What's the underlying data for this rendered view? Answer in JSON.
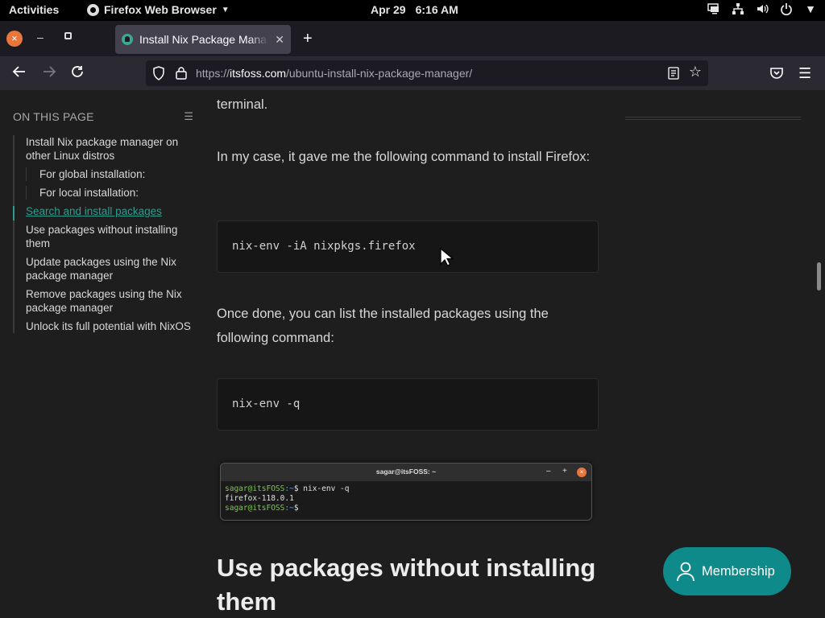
{
  "topbar": {
    "activities": "Activities",
    "app_name": "Firefox Web Browser",
    "date": "Apr 29",
    "time": "6:16 AM"
  },
  "tabs": [
    {
      "title": "Install Nix Package Manager",
      "favicon": "itsfoss-favicon"
    }
  ],
  "urlbar": {
    "scheme": "https://",
    "host": "itsfoss.com",
    "path": "/ubuntu-install-nix-package-manager/"
  },
  "toc": {
    "heading": "ON THIS PAGE",
    "items": [
      {
        "label": "Install Nix package manager on other Linux distros",
        "level": 1,
        "active": false
      },
      {
        "label": "For global installation:",
        "level": 2,
        "active": false
      },
      {
        "label": "For local installation:",
        "level": 2,
        "active": false
      },
      {
        "label": "Search and install packages",
        "level": 1,
        "active": true
      },
      {
        "label": "Use packages without installing them",
        "level": 1,
        "active": false
      },
      {
        "label": "Update packages using the Nix package manager",
        "level": 1,
        "active": false
      },
      {
        "label": "Remove packages using the Nix package manager",
        "level": 1,
        "active": false
      },
      {
        "label": "Unlock its full potential with NixOS",
        "level": 1,
        "active": false
      }
    ]
  },
  "article": {
    "p0": "terminal.",
    "p1": "In my case, it gave me the following command to install Firefox:",
    "code1": "nix-env -iA nixpkgs.firefox",
    "p2": "Once done, you can list the installed packages using the following command:",
    "code2": "nix-env -q",
    "terminal": {
      "title": "sagar@itsFOSS: ~",
      "min": "–",
      "max": "+",
      "close": "×",
      "line1_user": "sagar@itsFOSS",
      "line1_path": ":~",
      "line1_cmd": "$ nix-env -q",
      "line2": "firefox-118.0.1",
      "line3_user": "sagar@itsFOSS",
      "line3_path": ":~",
      "line3_cmd": "$"
    },
    "h2": "Use packages without installing them"
  },
  "membership_button": "Membership",
  "colors": {
    "accent": "#2a9d8f",
    "membership": "#0f8a8a",
    "window_close": "#e9773d"
  }
}
